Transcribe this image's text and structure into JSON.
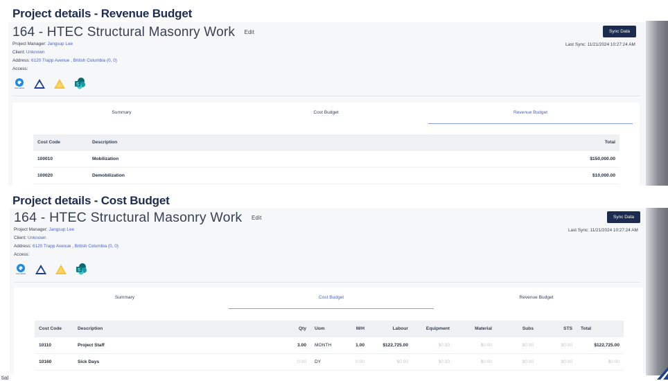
{
  "revenue_section": {
    "heading": "Project details - Revenue Budget",
    "project_title": "164 - HTEC Structural Masonry Work",
    "edit_label": "Edit",
    "sync_label": "Sync Data",
    "last_sync": "Last Sync: 11/21/2024 10:27:24 AM",
    "project_manager_label": "Project Manager:",
    "project_manager": "Jangsup Lee",
    "client_label": "Client:",
    "client": "Unknown",
    "address_label": "Address:",
    "address": "6120 Trapp Avenue , British Columbia (0, 0)",
    "access_label": "Access:",
    "tabs": [
      "Summary",
      "Cost Budget",
      "Revenue Budget"
    ],
    "active_tab": "Revenue Budget",
    "columns": [
      "Cost Code",
      "Description",
      "Total"
    ],
    "rows": [
      {
        "code": "100010",
        "description": "Mobilization",
        "total": "$150,000.00"
      },
      {
        "code": "100020",
        "description": "Demobilization",
        "total": "$10,000.00"
      }
    ]
  },
  "cost_section": {
    "heading": "Project details - Cost Budget",
    "project_title": "164 - HTEC Structural Masonry Work",
    "edit_label": "Edit",
    "sync_label": "Sync Data",
    "last_sync": "Last Sync: 11/21/2024 10:27:24 AM",
    "project_manager_label": "Project Manager:",
    "project_manager": "Jangsup Lee",
    "client_label": "Client:",
    "client": "Unknown",
    "address_label": "Address:",
    "address": "6120 Trapp Avenue , British Columbia (0, 0)",
    "access_label": "Access:",
    "tabs": [
      "Summary",
      "Cost Budget",
      "Revenue Budget"
    ],
    "active_tab": "Cost Budget",
    "columns": [
      "Cost Code",
      "Description",
      "Qty",
      "Uom",
      "M/H",
      "Labour",
      "Equipment",
      "Material",
      "Subs",
      "STS",
      "Total"
    ],
    "rows": [
      {
        "code": "10110",
        "description": "Project Staff",
        "qty": "3.00",
        "uom": "MONTH",
        "mh": "1.00",
        "labour": "$122,725.00",
        "equipment": "$0.00",
        "material": "$0.00",
        "subs": "$0.00",
        "sts": "$0.00",
        "total": "$122,725.00"
      },
      {
        "code": "10160",
        "description": "Sick Days",
        "qty": "0.00",
        "uom": "DY",
        "mh": "0.00",
        "labour": "$0.00",
        "equipment": "$0.00",
        "material": "$0.00",
        "subs": "$0.00",
        "sts": "$0.00",
        "total": "$0.00"
      }
    ]
  },
  "access_icons": [
    "acumatica-icon",
    "procore-triangle-icon",
    "warning-triangle-icon",
    "sharepoint-icon"
  ],
  "acumatica_caption": "Acumatica",
  "footer_fragment": "tial",
  "colors": {
    "brand_navy": "#1c2b50",
    "link_blue": "#4a63c9",
    "active_underline": "#8b9be0"
  }
}
